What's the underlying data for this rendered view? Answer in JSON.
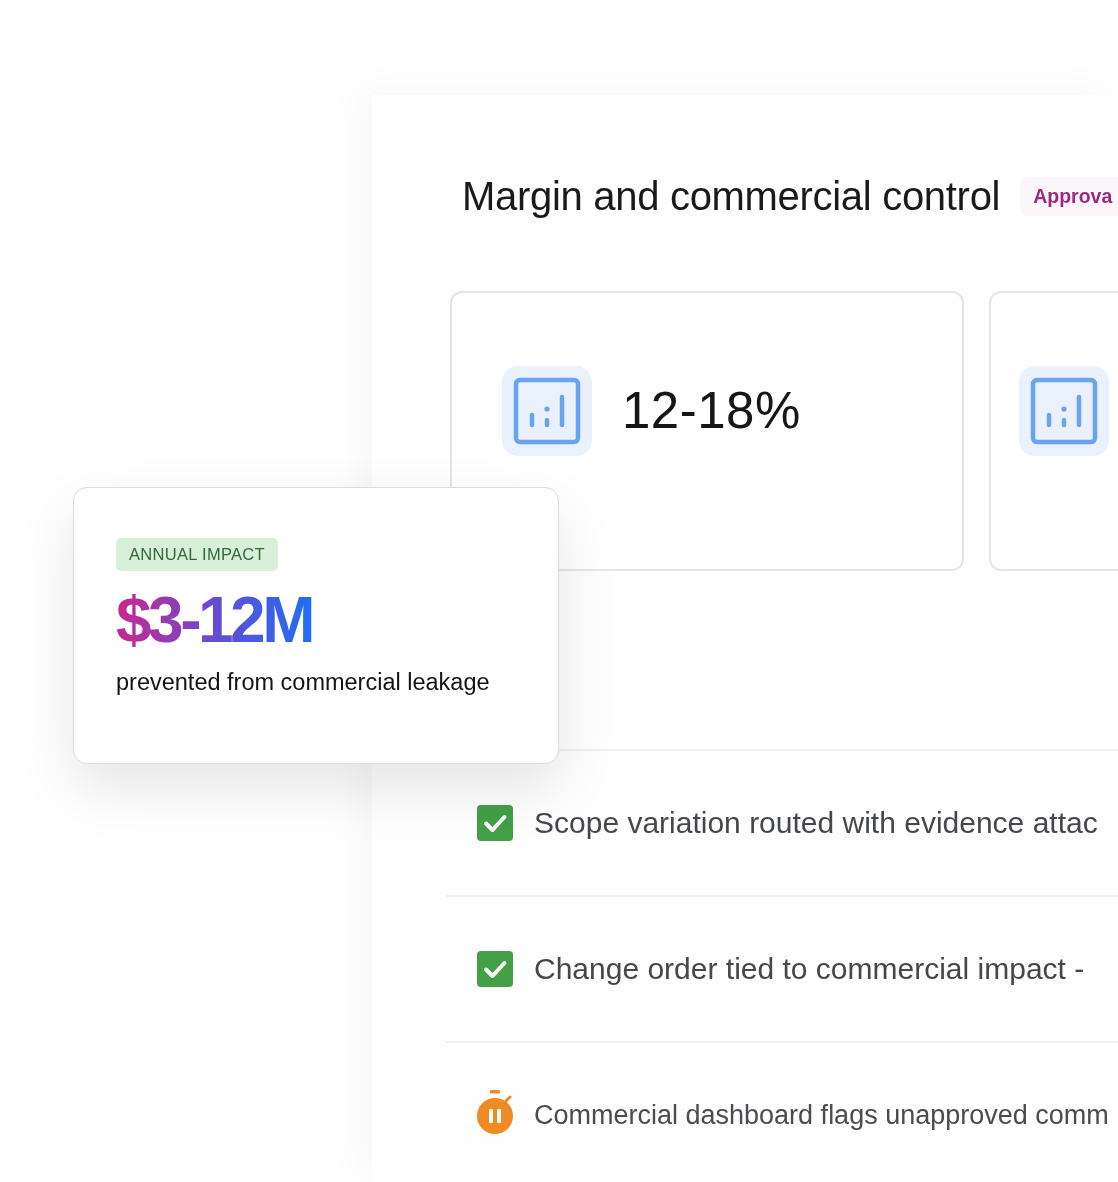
{
  "panel": {
    "title": "Margin and commercial control",
    "badge": "Approva"
  },
  "metric_cards": [
    {
      "kind": "full",
      "value": "12-18%"
    },
    {
      "kind": "clipped"
    }
  ],
  "highlight_card": {
    "tag": "ANNUAL IMPACT",
    "amount": "$3-12M",
    "caption": "prevented from commercial leakage"
  },
  "checklist": [
    {
      "kind": "check",
      "text": "Scope variation routed with evidence attac"
    },
    {
      "kind": "check",
      "text": "Change order tied to commercial impact -"
    },
    {
      "kind": "timer",
      "text": "Commercial dashboard flags unapproved comm"
    }
  ]
}
